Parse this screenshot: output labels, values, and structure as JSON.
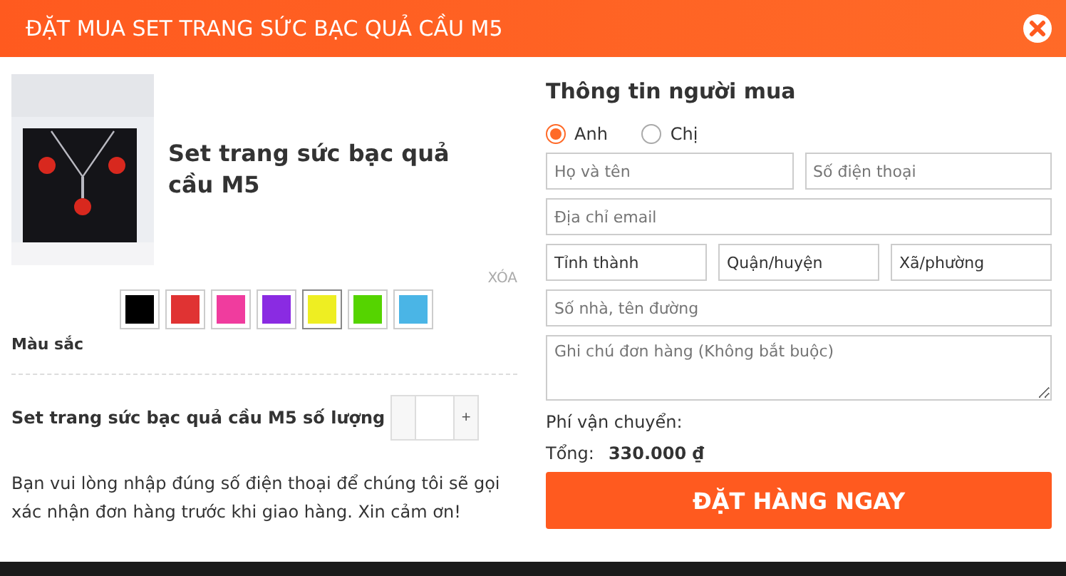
{
  "header": {
    "title": "ĐẶT MUA SET TRANG SỨC BẠC QUẢ CẦU M5"
  },
  "product": {
    "name": "Set trang sức bạc quả cầu M5",
    "remove": "XÓA",
    "colors": [
      {
        "color": "#000000",
        "selected": false
      },
      {
        "color": "#e03333",
        "selected": false
      },
      {
        "color": "#f03c9e",
        "selected": false
      },
      {
        "color": "#8a2be2",
        "selected": false
      },
      {
        "color": "#eeee22",
        "selected": true
      },
      {
        "color": "#55d400",
        "selected": false
      },
      {
        "color": "#4ab5e6",
        "selected": false
      }
    ],
    "color_label": "Màu sắc",
    "quantity_label": "Set trang sức bạc quả cầu M5 số lượng",
    "plus": "+"
  },
  "notice": "Bạn vui lòng nhập đúng số điện thoại để chúng tôi sẽ gọi xác nhận đơn hàng trước khi giao hàng. Xin cảm ơn!",
  "buyer": {
    "title": "Thông tin người mua",
    "gender": [
      {
        "label": "Anh",
        "selected": true
      },
      {
        "label": "Chị",
        "selected": false
      }
    ],
    "rows": [
      [
        {
          "placeholder": "Họ và tên"
        },
        {
          "placeholder": "Số điện thoại"
        }
      ],
      [
        {
          "placeholder": "Địa chỉ email"
        }
      ],
      [
        {
          "value": "Tỉnh thành",
          "kind": "select"
        },
        {
          "value": "Quận/huyện",
          "kind": "select"
        },
        {
          "value": "Xã/phường",
          "kind": "select"
        }
      ],
      [
        {
          "placeholder": "Số nhà, tên đường"
        }
      ]
    ],
    "note": {
      "placeholder": "Ghi chú đơn hàng (Không bắt buộc)"
    },
    "shipping_label": "Phí vận chuyển:",
    "total_label": "Tổng:",
    "total": "330.000 ₫",
    "submit": "ĐẶT HÀNG NGAY"
  }
}
